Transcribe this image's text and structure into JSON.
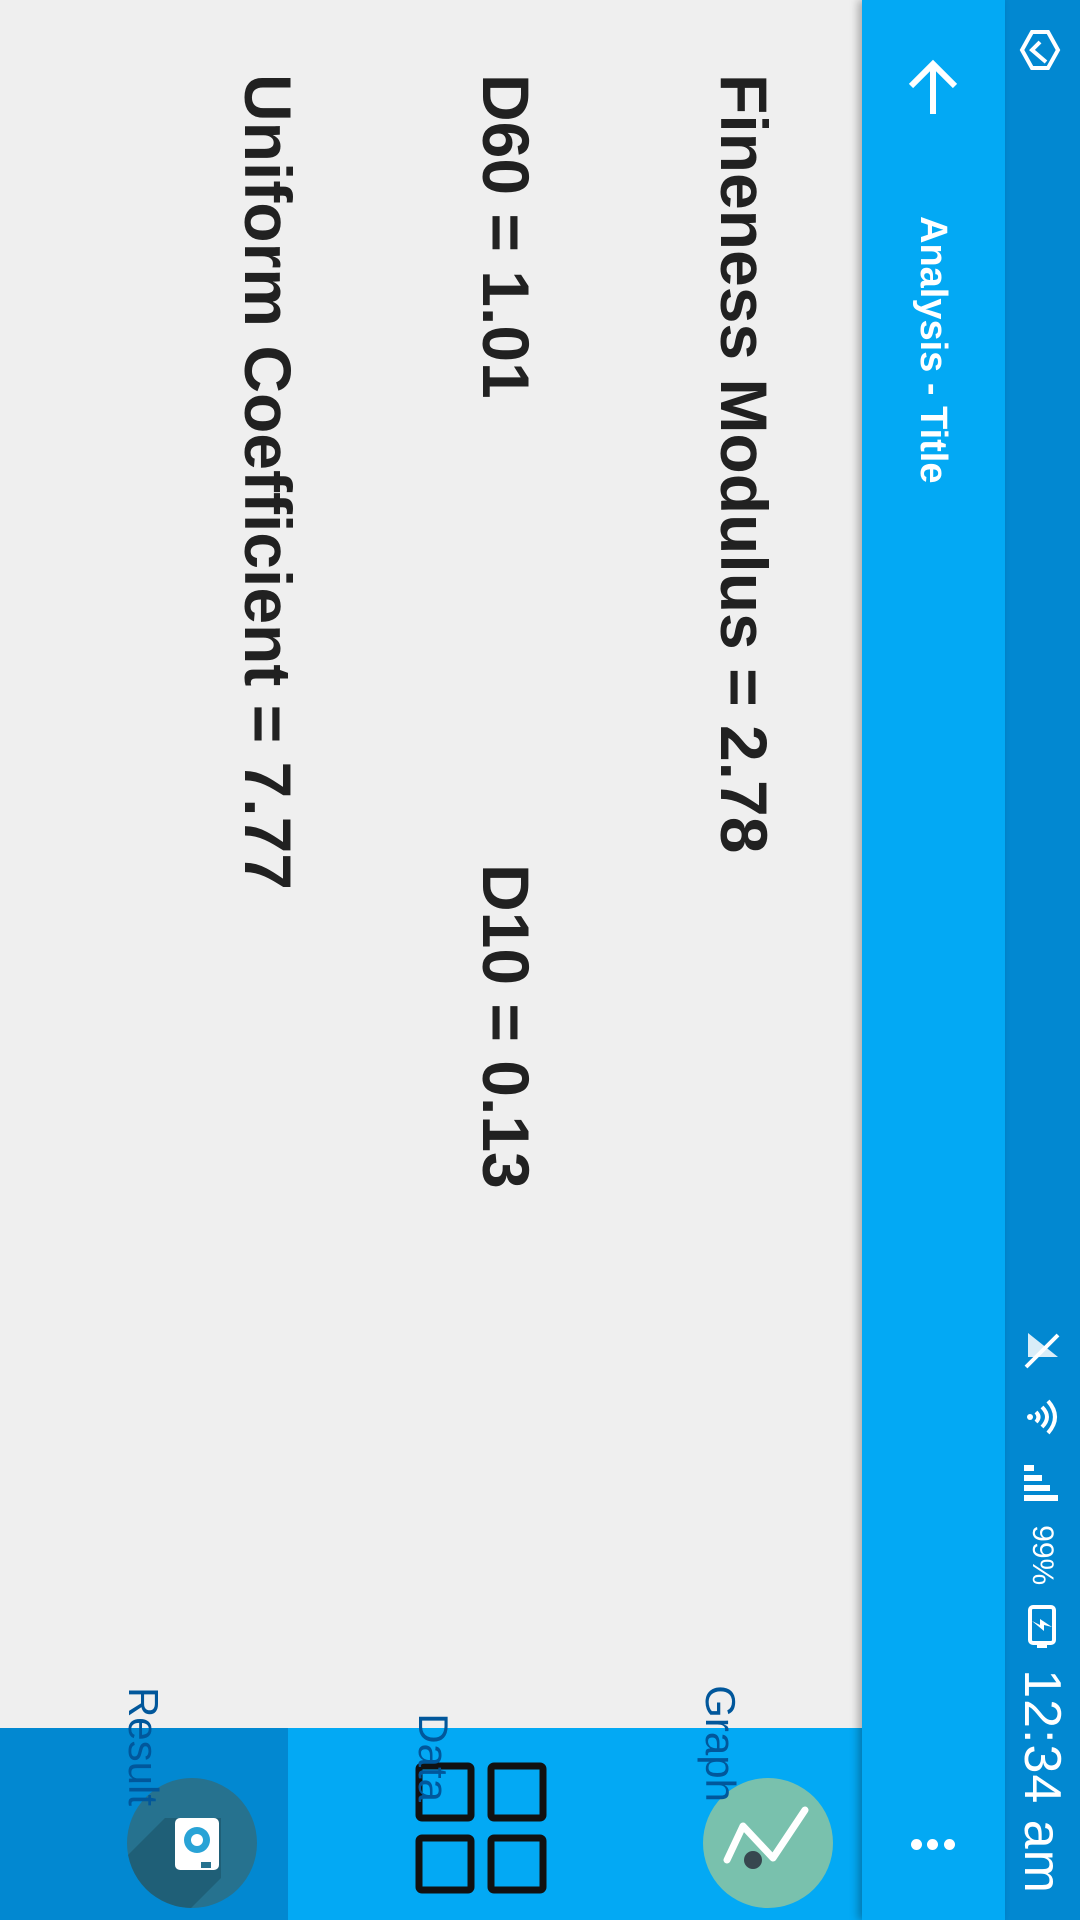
{
  "status_bar": {
    "time": "12:34 am",
    "battery": "99%",
    "icons": [
      "app-notification-icon",
      "signal-icon",
      "wifi-icon",
      "mute-icon",
      "battery-charging-icon"
    ]
  },
  "toolbar": {
    "title": "Analysis - Title",
    "back_icon": "arrow-back-icon",
    "overflow_icon": "more-vert-icon"
  },
  "results": {
    "fineness_modulus": "Fineness Modulus = 2.78",
    "d60": "D60 = 1.01",
    "d10": "D10 = 0.13",
    "uniform_coefficient": "Uniform Coefficient = 7.77"
  },
  "bottom_nav": {
    "items": [
      {
        "label": "Graph",
        "icon": "line-chart-icon",
        "active": false
      },
      {
        "label": "Data",
        "icon": "grid-icon",
        "active": false
      },
      {
        "label": "Result",
        "icon": "camera-icon",
        "active": true
      }
    ]
  },
  "colors": {
    "primary": "#03a9f4",
    "primary_dark": "#0288d1",
    "background": "#efefef",
    "text": "#212121",
    "nav_label": "#01579b",
    "graph_badge": "#79c1ad",
    "result_badge": "#26728f"
  }
}
